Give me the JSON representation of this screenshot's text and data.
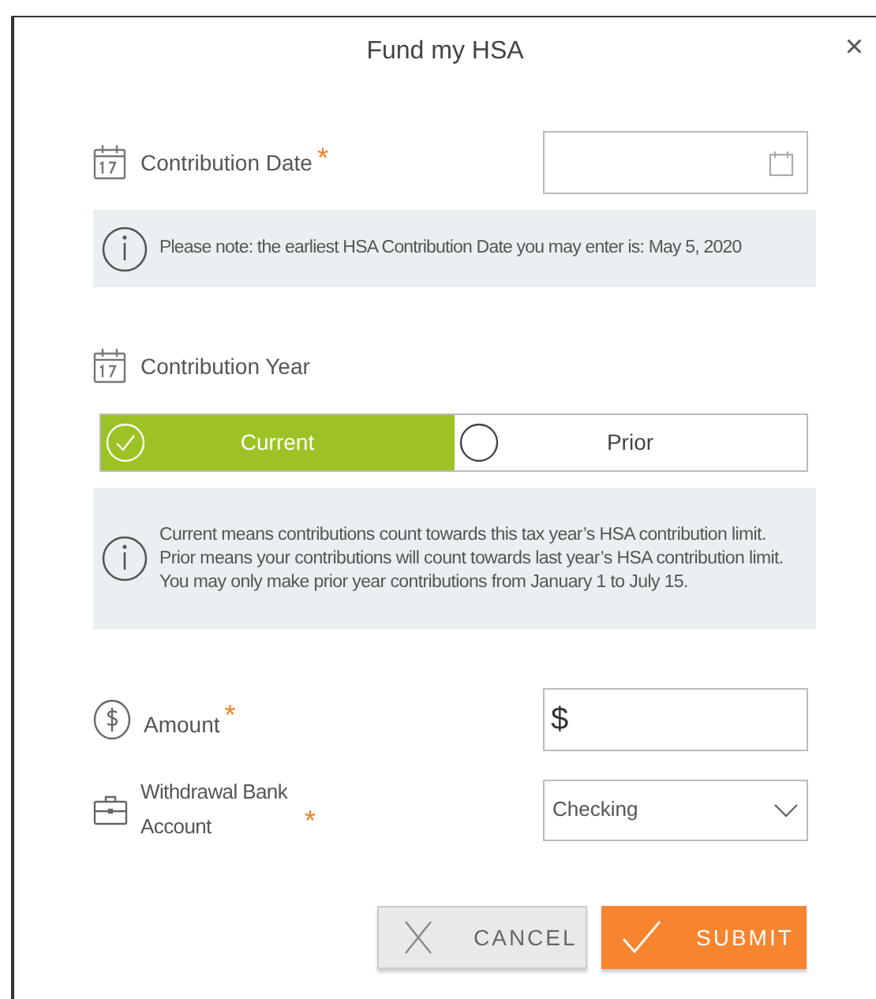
{
  "dialog": {
    "title": "Fund my HSA",
    "close": "×"
  },
  "contribution_date": {
    "label": "Contribution Date",
    "required_mark": "*"
  },
  "date_note": "Please note: the earliest HSA Contribution Date you may enter is: May 5, 2020",
  "contribution_year": {
    "label": "Contribution Year",
    "options": [
      {
        "label": "Current",
        "selected": true
      },
      {
        "label": "Prior",
        "selected": false
      }
    ]
  },
  "year_note": "Current means contributions count towards this tax year’s HSA contribution limit. Prior means your contributions will count towards last year’s HSA contribution limit. You may only make prior year contributions from January 1 to July 15.",
  "amount": {
    "label": "Amount",
    "required_mark": "*",
    "prefix": "$"
  },
  "bank_account": {
    "label": "Withdrawal Bank Account",
    "required_mark": "*",
    "value": "Checking"
  },
  "buttons": [
    {
      "kind": "cancel",
      "label": "CANCEL"
    },
    {
      "kind": "submit",
      "label": "SUBMIT"
    }
  ]
}
